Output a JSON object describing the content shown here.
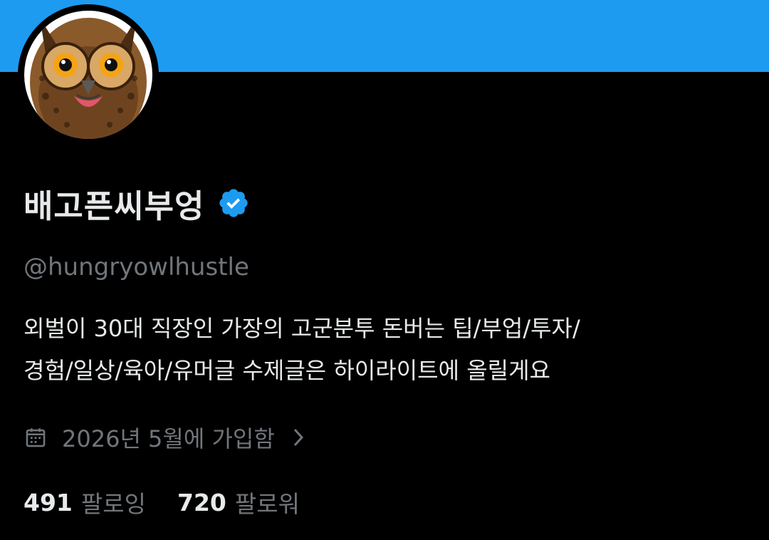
{
  "header": {
    "banner_color": "#1d9bf0"
  },
  "profile": {
    "display_name": "배고픈씨부엉",
    "verified": true,
    "handle": "@hungryowlhustle",
    "bio_lines": [
      "외벌이 30대 직장인 가장의 고군분투 돈버는 팁/부업/투자/",
      "경험/일상/육아/유머글 수제글은 하이라이트에 올릴게요"
    ],
    "joined": "2026년 5월에 가입함",
    "following_count": "491",
    "following_label": "팔로잉",
    "followers_count": "720",
    "followers_label": "팔로워"
  },
  "icons": {
    "avatar": "owl-avatar",
    "verified": "verified-badge-icon",
    "joined": "calendar-icon",
    "chevron": "chevron-right-icon"
  },
  "colors": {
    "background": "#000000",
    "text_primary": "#e7e9ea",
    "text_secondary": "#71767b",
    "accent": "#1d9bf0"
  }
}
